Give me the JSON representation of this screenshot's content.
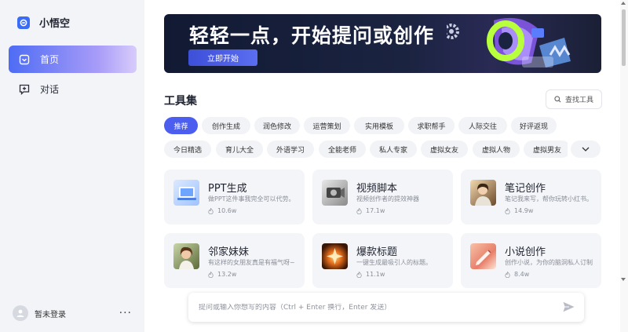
{
  "app": {
    "name": "小悟空",
    "accent": "#4c5ef0"
  },
  "sidebar": {
    "items": [
      {
        "label": "首页",
        "icon": "home-icon",
        "active": true
      },
      {
        "label": "对话",
        "icon": "chat-add-icon",
        "active": false
      }
    ],
    "user": {
      "name": "暂未登录",
      "more": "···"
    }
  },
  "banner": {
    "title": "轻轻一点，开始提问或创作",
    "button": "立即开始"
  },
  "tools": {
    "title": "工具集",
    "search_label": "查找工具",
    "categories_row1": [
      "推荐",
      "创作生成",
      "润色修改",
      "运营策划",
      "实用模板",
      "求职帮手",
      "人际交往",
      "好评返现"
    ],
    "categories_row2": [
      "今日精选",
      "育儿大全",
      "外语学习",
      "全能老师",
      "私人专家",
      "虚拟女友",
      "虚拟人物",
      "虚拟男友"
    ],
    "cards": [
      {
        "title": "PPT生成",
        "desc": "做PPT这件事我完全可以代劳。",
        "count": "10.6w"
      },
      {
        "title": "视频脚本",
        "desc": "视频创作者的提效神器",
        "count": "17.1w"
      },
      {
        "title": "笔记创作",
        "desc": "笔记我来写，帮你玩转小红书。",
        "count": "14.9w"
      },
      {
        "title": "邻家妹妹",
        "desc": "有这样的女朋友真是有福气呀~",
        "count": "13.2w"
      },
      {
        "title": "爆款标题",
        "desc": "一键生成最吸引人的标题。",
        "count": "11.1w"
      },
      {
        "title": "小说创作",
        "desc": "创作小说，为你的脑洞私人订制",
        "count": "8.4w"
      }
    ]
  },
  "prompt": {
    "placeholder": "提问或输入你想写的内容（Ctrl + Enter 换行，Enter 发送）"
  }
}
